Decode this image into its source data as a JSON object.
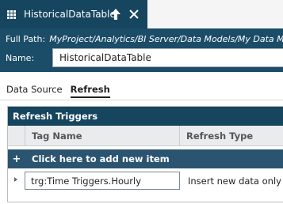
{
  "tab": {
    "title": "HistoricalDataTable",
    "pin_icon": "pin-up-arrow-icon",
    "close_icon": "close-icon",
    "table_icon": "table-grid-icon"
  },
  "header": {
    "full_path_label": "Full Path:",
    "full_path_value": "MyProject/Analytics/BI Server/Data Models/My Data Mod",
    "name_label": "Name:",
    "name_value": "HistoricalDataTable"
  },
  "subtabs": [
    {
      "label": "Data Source",
      "active": false
    },
    {
      "label": "Refresh",
      "active": true
    }
  ],
  "panel": {
    "title": "Refresh Triggers",
    "columns": [
      "Tag Name",
      "Refresh Type"
    ],
    "add_label": "Click here to add new item",
    "add_icon": "+",
    "rows": [
      {
        "tag_name": "trg:Time Triggers.Hourly",
        "refresh_type": "Insert new data only"
      }
    ]
  },
  "colors": {
    "tab_bg": "#16455f",
    "header_bg": "#1b4c68",
    "add_row_bg": "#2a5470",
    "column_header_bg": "#e9ebed"
  }
}
